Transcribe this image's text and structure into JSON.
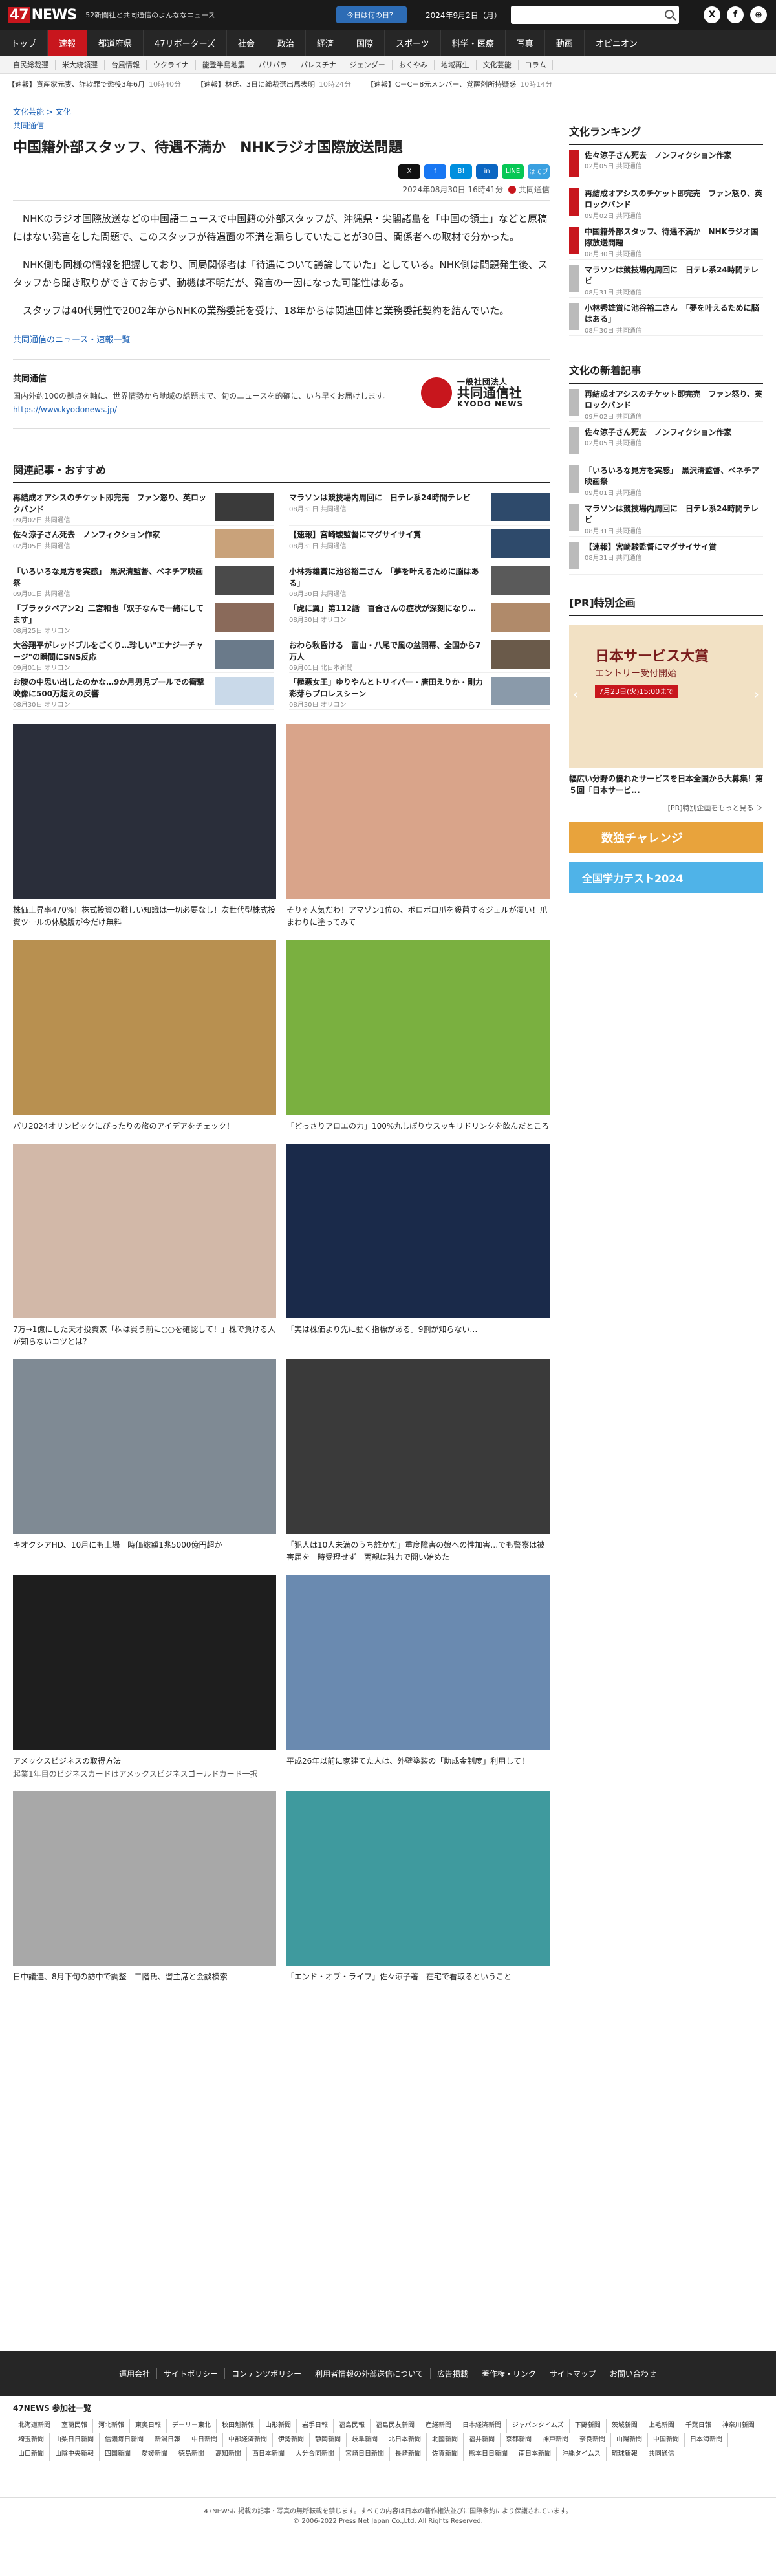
{
  "header": {
    "logo": "47NEWS",
    "tagline": "52新聞社と共同通信のよんななニュース",
    "today_button": "今日は何の日？",
    "date": "2024年9月2日（月）",
    "social": [
      "X",
      "f",
      "⊕"
    ]
  },
  "nav": [
    "トップ",
    "速報",
    "都道府県",
    "47リポーターズ",
    "社会",
    "政治",
    "経済",
    "国際",
    "スポーツ",
    "科学・医療",
    "写真",
    "動画",
    "オピニオン"
  ],
  "subnav": [
    "自民総裁選",
    "米大統領選",
    "台風情報",
    "ウクライナ",
    "能登半島地震",
    "パリパラ",
    "パレスチナ",
    "ジェンダー",
    "おくやみ",
    "地域再生",
    "文化芸能",
    "コラム"
  ],
  "ticker": [
    {
      "text": "【速報】資産家元妻、詐欺罪で懲役3年6月",
      "time": "10時40分"
    },
    {
      "text": "【速報】林氏、3日に総裁選出馬表明",
      "time": "10時24分"
    },
    {
      "text": "【速報】C－C－8元メンバー、覚醒剤所持疑惑",
      "time": "10時14分"
    }
  ],
  "article": {
    "breadcrumb": "文化芸能 > 文化",
    "source_link": "共同通信",
    "title": "中国籍外部スタッフ、待遇不満か　NHKラジオ国際放送問題",
    "share": [
      "X",
      "f",
      "B!",
      "in",
      "LINE",
      "はてブ"
    ],
    "date": "2024年08月30日 16時41分",
    "source": "共同通信",
    "paragraphs": [
      "NHKのラジオ国際放送などの中国語ニュースで中国籍の外部スタッフが、沖縄県・尖閣諸島を「中国の領土」などと原稿にはない発言をした問題で、このスタッフが待遇面の不満を漏らしていたことが30日、関係者への取材で分かった。",
      "NHK側も同様の情報を把握しており、同局関係者は「待遇について議論していた」としている。NHK側は問題発生後、スタッフから聞き取りができておらず、動機は不明だが、発言の一因になった可能性はある。",
      "スタッフは40代男性で2002年からNHKの業務委託を受け、18年からは関連団体と業務委託契約を結んでいた。"
    ],
    "news_link": "共同通信のニュース・速報一覧",
    "kyodo_heading": "共同通信",
    "kyodo_desc": "国内外約100の拠点を軸に、世界情勢から地域の話題まで、旬のニュースを的確に、いち早くお届けします。",
    "kyodo_url": "https://www.kyodonews.jp/",
    "kyodo_logo_small": "一般社団法人",
    "kyodo_logo_jp": "共同通信社",
    "kyodo_logo_en": "KYODO NEWS"
  },
  "related": {
    "heading": "関連記事・おすすめ",
    "items": [
      {
        "title": "再結成オアシスのチケット即完売　ファン怒り、英ロックバンド",
        "sub": "09月02日 共同通信"
      },
      {
        "title": "マラソンは競技場内周回に　日テレ系24時間テレビ",
        "sub": "08月31日 共同通信"
      },
      {
        "title": "佐々涼子さん死去　ノンフィクション作家",
        "sub": "02月05日 共同通信"
      },
      {
        "title": "【速報】宮崎駿監督にマグサイサイ賞",
        "sub": "08月31日 共同通信"
      },
      {
        "title": "「いろいろな見方を実感」　黒沢清監督、ベネチア映画祭",
        "sub": "09月01日 共同通信"
      },
      {
        "title": "小林秀雄賞に池谷裕二さん　「夢を叶えるために脳はある」",
        "sub": "08月30日 共同通信"
      },
      {
        "title": "「ブラックペアン2」二宮和也「双子なんで一緒にしてます」",
        "sub": "08月25日 オリコン"
      },
      {
        "title": "「虎に翼」第112話　百合さんの症状が深刻になり…",
        "sub": "08月30日 オリコン"
      },
      {
        "title": "大谷翔平がレッドブルをごくり…珍しい\"エナジーチャージ\"の瞬間にSNS反応",
        "sub": "09月01日 オリコン"
      },
      {
        "title": "おわら秋昏ける　富山・八尾で風の盆開幕、全国から7万人",
        "sub": "09月01日 北日本新聞"
      },
      {
        "title": "お腹の中思い出したのかな…9か月男児プールでの衝撃映像に500万超えの反響",
        "sub": "08月30日 オリコン"
      },
      {
        "title": "「極悪女王」ゆりやんとトリイバー・唐田えりか・剛力彩芽らプロレスシーン",
        "sub": "08月30日 オリコン"
      }
    ]
  },
  "promos": [
    {
      "caption": "株価上昇率470%！株式投資の難しい知識は一切必要なし！次世代型株式投資ツールの体験版が今だけ無料",
      "sub": ""
    },
    {
      "caption": "そりゃ人気だわ！アマゾン1位の、ボロボロ爪を殺菌するジェルが凄い！爪まわりに塗ってみて",
      "sub": ""
    },
    {
      "caption": "パリ2024オリンピックにぴったりの旅のアイデアをチェック！",
      "sub": ""
    },
    {
      "caption": "「どっさりアロエの力」100%丸しぼりウスッキリドリンクを飲んだところ",
      "sub": ""
    },
    {
      "caption": "7万→1億にした天才投資家「株は買う前に○○を確認して！」株で負ける人が知らないコツとは？",
      "sub": ""
    },
    {
      "caption": "「実は株価より先に動く指標がある」9割が知らない…",
      "sub": ""
    },
    {
      "caption": "キオクシアHD、10月にも上場　時価総額1兆5000億円超か",
      "sub": ""
    },
    {
      "caption": "「犯人は10人未満のうち誰かだ」重度障害の娘への性加害…でも警察は被害届を一時受理せず　両親は独力で開い始めた",
      "sub": ""
    },
    {
      "caption": "アメックスビジネスの取得方法",
      "sub": "起業1年目のビジネスカードはアメックスビジネスゴールドカード一択"
    },
    {
      "caption": "平成26年以前に家建てた人は、外壁塗装の「助成金制度」利用して！",
      "sub": ""
    },
    {
      "caption": "日中議連、8月下旬の訪中で調整　二階氏、習主席と会談模索",
      "sub": ""
    },
    {
      "caption": "「エンド・オブ・ライフ」佐々涼子著　在宅で看取るということ",
      "sub": ""
    }
  ],
  "sidebar": {
    "ranking_heading": "文化ランキング",
    "ranking": [
      {
        "title": "佐々涼子さん死去　ノンフィクション作家",
        "sub": "02月05日 共同通信"
      },
      {
        "title": "再結成オアシスのチケット即完売　ファン怒り、英ロックバンド",
        "sub": "09月02日 共同通信"
      },
      {
        "title": "中国籍外部スタッフ、待遇不満か　NHKラジオ国際放送問題",
        "sub": "08月30日 共同通信"
      },
      {
        "title": "マラソンは競技場内周回に　日テレ系24時間テレビ",
        "sub": "08月31日 共同通信"
      },
      {
        "title": "小林秀雄賞に池谷裕二さん　「夢を叶えるために脳はある」",
        "sub": "08月30日 共同通信"
      }
    ],
    "new_heading": "文化の新着記事",
    "new_items": [
      {
        "title": "再結成オアシスのチケット即完売　ファン怒り、英ロックバンド",
        "sub": "09月02日 共同通信"
      },
      {
        "title": "佐々涼子さん死去　ノンフィクション作家",
        "sub": "02月05日 共同通信"
      },
      {
        "title": "「いろいろな見方を実感」　黒沢清監督、ベネチア映画祭",
        "sub": "09月01日 共同通信"
      },
      {
        "title": "マラソンは競技場内周回に　日テレ系24時間テレビ",
        "sub": "08月31日 共同通信"
      },
      {
        "title": "【速報】宮崎駿監督にマグサイサイ賞",
        "sub": "08月31日 共同通信"
      }
    ],
    "pr_heading": "[PR]特別企画",
    "ad_title": "日本サービス大賞",
    "ad_sub": "エントリー受付開始",
    "ad_date": "7月23日(火)15:00まで",
    "ad_caption": "幅広い分野の優れたサービスを日本全国から大募集！第５回「日本サービ...",
    "ad_more": "[PR]特別企画をもっと見る ＞",
    "banner1": "数独チャレンジ",
    "banner2": "全国学力テスト2024"
  },
  "footer": {
    "links": [
      "運用会社",
      "サイトポリシー",
      "コンテンツポリシー",
      "利用者情報の外部送信について",
      "広告掲載",
      "著作権・リンク",
      "サイトマップ",
      "お問い合わせ"
    ],
    "members_heading": "47NEWS 参加社一覧",
    "members": [
      "北海道新聞",
      "室蘭民報",
      "河北新報",
      "東奥日報",
      "デーリー東北",
      "秋田魁新報",
      "山形新聞",
      "岩手日報",
      "福島民報",
      "福島民友新聞",
      "産経新聞",
      "日本経済新聞",
      "ジャパンタイムズ",
      "下野新聞",
      "茨城新聞",
      "上毛新聞",
      "千葉日報",
      "神奈川新聞",
      "埼玉新聞",
      "山梨日日新聞",
      "信濃毎日新聞",
      "新潟日報",
      "中日新聞",
      "中部経済新聞",
      "伊勢新聞",
      "静岡新聞",
      "岐阜新聞",
      "北日本新聞",
      "北國新聞",
      "福井新聞",
      "京都新聞",
      "神戸新聞",
      "奈良新聞",
      "山陽新聞",
      "中国新聞",
      "日本海新聞",
      "山口新聞",
      "山陰中央新報",
      "四国新聞",
      "愛媛新聞",
      "徳島新聞",
      "高知新聞",
      "西日本新聞",
      "大分合同新聞",
      "宮崎日日新聞",
      "長崎新聞",
      "佐賀新聞",
      "熊本日日新聞",
      "南日本新聞",
      "沖縄タイムス",
      "琉球新報",
      "共同通信"
    ],
    "notice": "47NEWSに掲載の記事・写真の無断転載を禁じます。すべての内容は日本の著作権法並びに国際条約により保護されています。",
    "copyright": "© 2006-2022 Press Net Japan Co.,Ltd. All Rights Reserved."
  }
}
